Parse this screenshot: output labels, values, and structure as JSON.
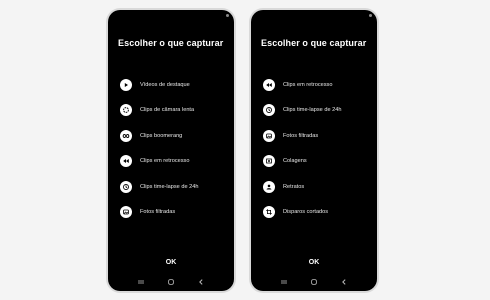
{
  "left_screen": {
    "title": "Escolher o que capturar",
    "items": [
      {
        "label": "Vídeos de destaque",
        "icon": "play-icon"
      },
      {
        "label": "Clips de câmara lenta",
        "icon": "slow-motion-icon"
      },
      {
        "label": "Clips boomerang",
        "icon": "boomerang-icon"
      },
      {
        "label": "Clips em retrocesso",
        "icon": "rewind-icon"
      },
      {
        "label": "Clips time-lapse de 24h",
        "icon": "timelapse-icon"
      },
      {
        "label": "Fotos filtradas",
        "icon": "filter-photo-icon"
      }
    ],
    "ok_label": "OK"
  },
  "right_screen": {
    "title": "Escolher o que capturar",
    "items": [
      {
        "label": "Clips em retrocesso",
        "icon": "rewind-icon"
      },
      {
        "label": "Clips time-lapse de 24h",
        "icon": "timelapse-icon"
      },
      {
        "label": "Fotos filtradas",
        "icon": "filter-photo-icon"
      },
      {
        "label": "Colagens",
        "icon": "collage-icon"
      },
      {
        "label": "Retratos",
        "icon": "portrait-icon"
      },
      {
        "label": "Disparos cortados",
        "icon": "crop-icon"
      }
    ],
    "ok_label": "OK"
  },
  "navbar": {
    "buttons": [
      "recents-icon",
      "home-icon",
      "back-icon"
    ]
  }
}
